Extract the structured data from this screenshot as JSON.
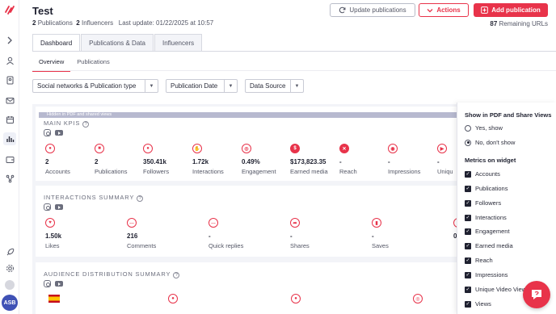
{
  "header": {
    "title": "Test",
    "publications_count": "2",
    "publications_label": "Publications",
    "influencers_count": "2",
    "influencers_label": "Influencers",
    "last_update": "Last update: 01/22/2025 at 10:57",
    "update_button": "Update publications",
    "actions_button": "Actions",
    "add_button": "Add publication",
    "remaining_count": "87",
    "remaining_label": "Remaining URLs"
  },
  "tabs": [
    {
      "label": "Dashboard",
      "active": true
    },
    {
      "label": "Publications & Data",
      "active": false
    },
    {
      "label": "Influencers",
      "active": false
    }
  ],
  "subtabs": [
    {
      "label": "Overview",
      "active": true
    },
    {
      "label": "Publications",
      "active": false
    }
  ],
  "filters": [
    {
      "label": "Social networks & Publication type"
    },
    {
      "label": "Publication Date"
    },
    {
      "label": "Data Source"
    }
  ],
  "hidden_banner": "Hidden in PDF and shared views",
  "main_kpis": {
    "title": "MAIN KPIS",
    "items": [
      {
        "value": "2",
        "label": "Accounts",
        "icon": "user-icon"
      },
      {
        "value": "2",
        "label": "Publications",
        "icon": "publication-icon"
      },
      {
        "value": "350.41k",
        "label": "Followers",
        "icon": "followers-icon"
      },
      {
        "value": "1.72k",
        "label": "Interactions",
        "icon": "interactions-icon"
      },
      {
        "value": "0.49%",
        "label": "Engagement",
        "icon": "engagement-icon"
      },
      {
        "value": "$173,823.35",
        "label": "Earned media",
        "icon": "dollar-icon"
      },
      {
        "value": "-",
        "label": "Reach",
        "icon": "reach-icon"
      },
      {
        "value": "-",
        "label": "Impressions",
        "icon": "eye-icon"
      },
      {
        "value": "-",
        "label": "Uniqu",
        "icon": "play-icon"
      }
    ]
  },
  "interactions_summary": {
    "title": "INTERACTIONS SUMMARY",
    "items": [
      {
        "value": "1.50k",
        "label": "Likes",
        "icon": "heart-icon"
      },
      {
        "value": "216",
        "label": "Comments",
        "icon": "comment-icon"
      },
      {
        "value": "-",
        "label": "Quick replies",
        "icon": "quick-reply-icon"
      },
      {
        "value": "-",
        "label": "Shares",
        "icon": "share-icon"
      },
      {
        "value": "-",
        "label": "Saves",
        "icon": "save-icon"
      },
      {
        "value": "0",
        "label": "",
        "icon": "more-icon"
      }
    ]
  },
  "audience_summary": {
    "title": "AUDIENCE DISTRIBUTION SUMMARY"
  },
  "panel": {
    "show_title": "Show in PDF and Share Views",
    "option_yes": "Yes, show",
    "option_no": "No, don't show",
    "metrics_title": "Metrics on widget",
    "metrics": [
      "Accounts",
      "Publications",
      "Followers",
      "Interactions",
      "Engagement",
      "Earned media",
      "Reach",
      "Impressions",
      "Unique Video Views",
      "Views"
    ]
  },
  "avatar": "ASB"
}
